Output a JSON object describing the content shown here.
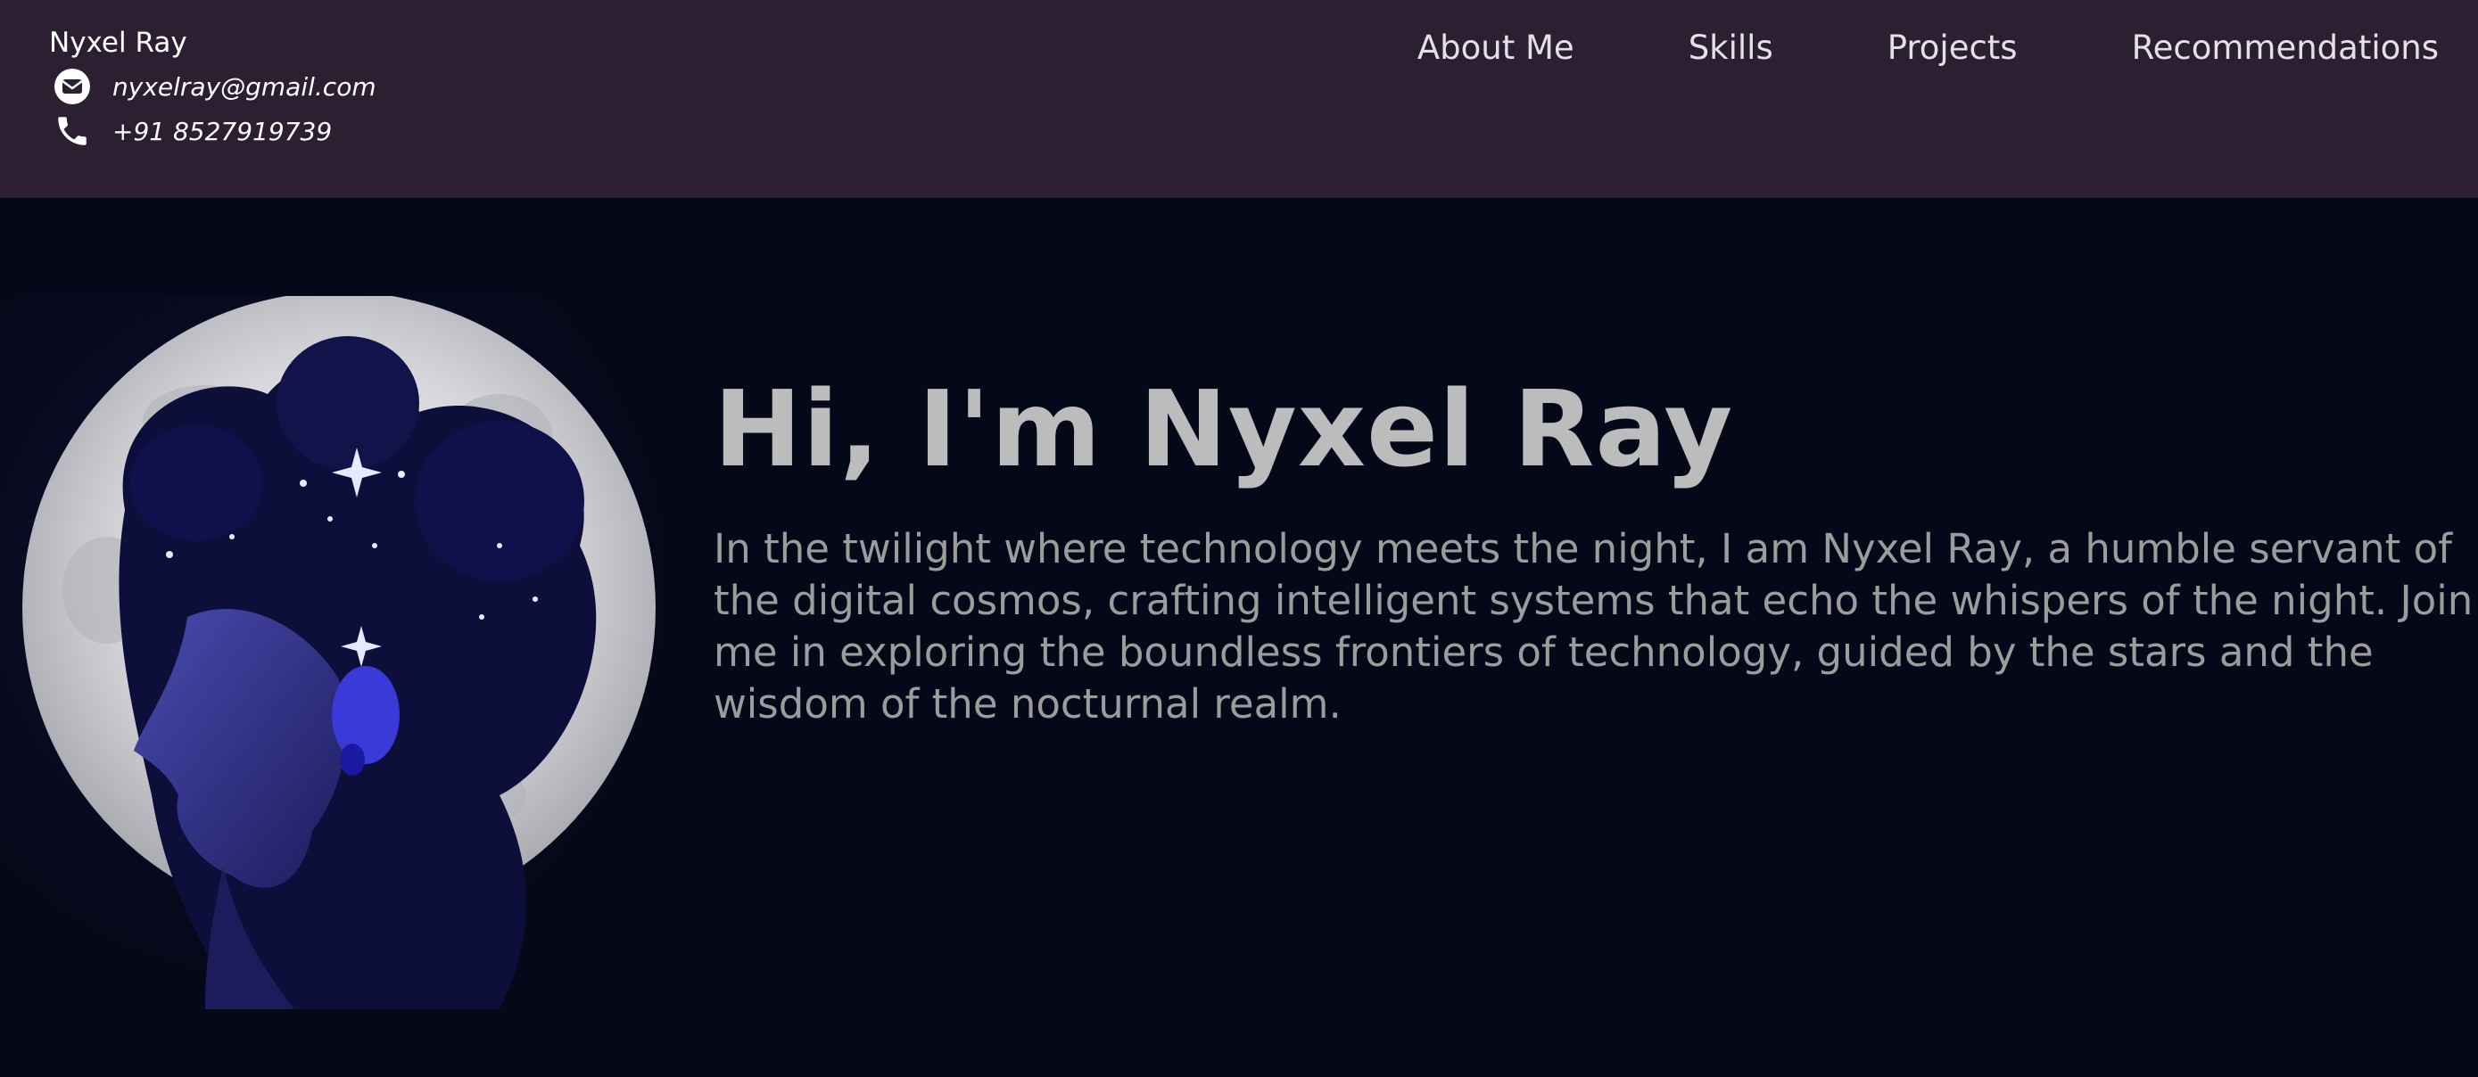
{
  "header": {
    "name": "Nyxel Ray",
    "email": "nyxelray@gmail.com",
    "phone": "+91 8527919739",
    "email_icon": "envelope-icon",
    "phone_icon": "phone-icon"
  },
  "nav": {
    "items": [
      {
        "label": "About Me"
      },
      {
        "label": "Skills"
      },
      {
        "label": "Projects"
      },
      {
        "label": "Recommendations"
      }
    ]
  },
  "hero": {
    "title": "Hi, I'm Nyxel Ray",
    "description": "In the twilight where technology meets the night, I am Nyxel Ray, a humble servant of\nthe digital cosmos, crafting intelligent systems that echo the whispers of the night. Join\nme in exploring the boundless frontiers of technology, guided by the stars and the\nwisdom of the nocturnal realm."
  },
  "colors": {
    "header_bg": "#2c1f31",
    "page_bg": "#050818",
    "title": "#bcbcbc",
    "body_text": "#9c9c9c"
  }
}
